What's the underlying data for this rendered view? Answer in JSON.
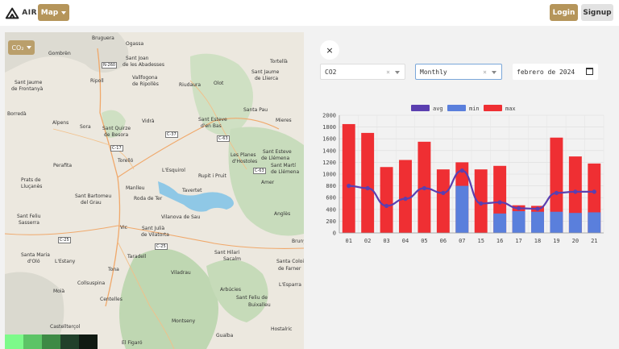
{
  "app": {
    "logo_text": "AIR"
  },
  "header": {
    "map_menu_label": "Map",
    "login_label": "Login",
    "signup_label": "Signup"
  },
  "map": {
    "pollutant_button_label": "CO₂",
    "legend_colors": [
      "#7dfa8a",
      "#5cc466",
      "#3d8a45",
      "#21402a",
      "#101a12"
    ],
    "places": [
      [
        "Bruguera",
        108,
        4
      ],
      [
        "Ogassa",
        150,
        11
      ],
      [
        "Gombrèn",
        54,
        23
      ],
      [
        "Sant Joan",
        150,
        29
      ],
      [
        "de les Abadesses",
        146,
        37
      ],
      [
        "Tortellà",
        329,
        33
      ],
      [
        "Sant Jaume",
        306,
        46
      ],
      [
        "de Llierca",
        310,
        54
      ],
      [
        "Ripoll",
        106,
        57
      ],
      [
        "Vallfogona",
        158,
        53
      ],
      [
        "de Ripollès",
        158,
        61
      ],
      [
        "Riudaura",
        216,
        62
      ],
      [
        "Olot",
        259,
        60
      ],
      [
        "Sant Jaume",
        12,
        59
      ],
      [
        "de Frontanyà",
        8,
        67
      ],
      [
        "Santa Pau",
        296,
        93
      ],
      [
        "Borredà",
        3,
        98
      ],
      [
        "Alpens",
        59,
        109
      ],
      [
        "Sora",
        93,
        114
      ],
      [
        "Sant Quirze",
        121,
        116
      ],
      [
        "de Besora",
        123,
        124
      ],
      [
        "Vidrà",
        170,
        107
      ],
      [
        "Sant Esteve",
        240,
        105
      ],
      [
        "d'en Bas",
        243,
        113
      ],
      [
        "Mieres",
        336,
        106
      ],
      [
        "Sant Esteve",
        320,
        145
      ],
      [
        "de Llémena",
        318,
        153
      ],
      [
        "Les Planes",
        280,
        149
      ],
      [
        "d'Hostoles",
        282,
        157
      ],
      [
        "Sant Martí",
        330,
        162
      ],
      [
        "de Llémena",
        330,
        170
      ],
      [
        "Perafita",
        60,
        162
      ],
      [
        "Torelló",
        140,
        156
      ],
      [
        "L'Esquirol",
        195,
        168
      ],
      [
        "Rupit i Pruit",
        240,
        175
      ],
      [
        "Amer",
        318,
        183
      ],
      [
        "Prats de",
        20,
        180
      ],
      [
        "Lluçanès",
        20,
        188
      ],
      [
        "Manlleu",
        150,
        190
      ],
      [
        "Roda de Ter",
        160,
        203
      ],
      [
        "Tavertet",
        220,
        193
      ],
      [
        "Sant Bartomeu",
        87,
        200
      ],
      [
        "del Grau",
        94,
        208
      ],
      [
        "Anglès",
        334,
        222
      ],
      [
        "Sant Feliu",
        15,
        225
      ],
      [
        "Sasserra",
        17,
        233
      ],
      [
        "Vilanova de Sau",
        194,
        226
      ],
      [
        "Vic",
        143,
        239
      ],
      [
        "Sant Julià",
        170,
        240
      ],
      [
        "de Vilatorta",
        169,
        248
      ],
      [
        "Bruny",
        356,
        256
      ],
      [
        "Santa Maria",
        20,
        273
      ],
      [
        "d'Oló",
        28,
        281
      ],
      [
        "L'Estany",
        62,
        281
      ],
      [
        "Taradell",
        152,
        275
      ],
      [
        "Sant Hilari",
        260,
        270
      ],
      [
        "Sacalm",
        271,
        278
      ],
      [
        "Santa Coloi",
        337,
        281
      ],
      [
        "de Farner",
        339,
        290
      ],
      [
        "Tona",
        128,
        291
      ],
      [
        "Collsuspina",
        90,
        308
      ],
      [
        "Viladrau",
        206,
        295
      ],
      [
        "L'Esparra",
        340,
        310
      ],
      [
        "Moià",
        60,
        318
      ],
      [
        "Arbúcies",
        267,
        316
      ],
      [
        "Centelles",
        118,
        328
      ],
      [
        "Sant Feliu de",
        287,
        326
      ],
      [
        "Buixalleu",
        302,
        335
      ],
      [
        "Montseny",
        207,
        355
      ],
      [
        "Castellterçol",
        56,
        362
      ],
      [
        "Hostalric",
        330,
        365
      ],
      [
        "Gualba",
        262,
        373
      ],
      [
        "El Figaró",
        145,
        382
      ]
    ],
    "roads": [
      [
        "N-260",
        120,
        37
      ],
      [
        "C-37",
        199,
        123
      ],
      [
        "C-63",
        263,
        128
      ],
      [
        "C-17",
        131,
        140
      ],
      [
        "C-63",
        308,
        168
      ],
      [
        "C-25",
        186,
        262
      ],
      [
        "C-25",
        66,
        254
      ]
    ]
  },
  "panel": {
    "close_label": "×",
    "pollutant_select": {
      "value": "CO2",
      "clear": "×"
    },
    "period_select": {
      "value": "Monthly",
      "clear": "×"
    },
    "date_input": {
      "value": "febrero de 2024"
    }
  },
  "chart_data": {
    "type": "bar",
    "categories": [
      "01",
      "02",
      "03",
      "04",
      "05",
      "06",
      "07",
      "15",
      "16",
      "17",
      "18",
      "19",
      "20",
      "21"
    ],
    "series": [
      {
        "name": "avg",
        "type": "line",
        "color": "#5b3fb0",
        "values": [
          800,
          760,
          460,
          580,
          760,
          680,
          1060,
          500,
          520,
          420,
          410,
          680,
          700,
          700
        ]
      },
      {
        "name": "min",
        "type": "bar",
        "color": "#5a7fdc",
        "values": [
          0,
          0,
          0,
          0,
          0,
          0,
          800,
          0,
          330,
          370,
          360,
          360,
          340,
          350
        ]
      },
      {
        "name": "max",
        "type": "bar",
        "color": "#ef2f33",
        "values": [
          1850,
          1700,
          1120,
          1240,
          1550,
          1080,
          1200,
          1080,
          1140,
          470,
          460,
          1620,
          1300,
          1180
        ]
      }
    ],
    "yticks": [
      "0",
      "200",
      "400",
      "600",
      "800",
      "1000",
      "1200",
      "1400",
      "1600",
      "1800",
      "2000"
    ],
    "ylim": [
      0,
      2000
    ],
    "grid": true,
    "legend": "top-center"
  }
}
